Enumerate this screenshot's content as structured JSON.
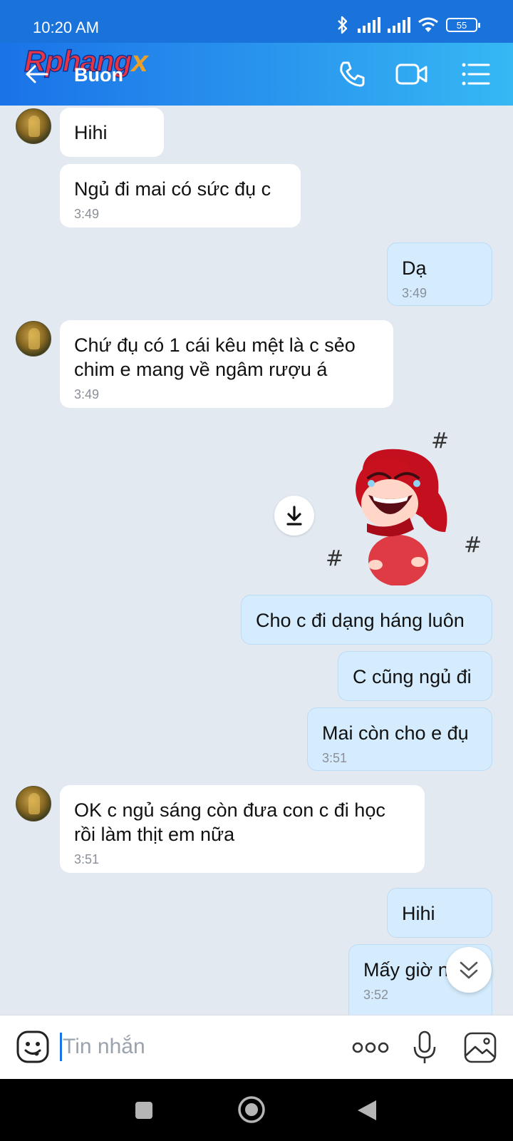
{
  "status_bar": {
    "time": "10:20 AM",
    "battery": "55"
  },
  "header": {
    "contact_name": "Buon",
    "watermark_main": "Rphang",
    "watermark_accent": "x"
  },
  "messages": [
    {
      "side": "in",
      "text": "Hihi",
      "time": ""
    },
    {
      "side": "in",
      "text": "Ngủ đi mai có sức đụ c",
      "time": "3:49"
    },
    {
      "side": "out",
      "text": "Dạ",
      "time": "3:49"
    },
    {
      "side": "in",
      "text": "Chứ đụ có 1 cái kêu mệt là c sẻo\nchim e mang về ngâm rượu á",
      "time": "3:49"
    },
    {
      "side": "out",
      "text": "Cho c đi dạng háng luôn",
      "time": ""
    },
    {
      "side": "out",
      "text": "C cũng ngủ đi",
      "time": ""
    },
    {
      "side": "out",
      "text": "Mai còn cho e đụ",
      "time": "3:51"
    },
    {
      "side": "in",
      "text": "OK c ngủ sáng còn đưa con c đi học\nrồi làm thịt em nữa",
      "time": "3:51"
    },
    {
      "side": "out",
      "text": "Hihi",
      "time": ""
    },
    {
      "side": "out",
      "text": "Mấy giờ nè",
      "time": "3:52"
    }
  ],
  "sticker": {
    "marks": [
      "#",
      "#",
      "#"
    ]
  },
  "composer": {
    "placeholder": "Tin nhắn"
  },
  "icons": {
    "back": "arrow-left-icon",
    "call": "phone-icon",
    "video": "video-camera-icon",
    "menu": "list-menu-icon",
    "download": "download-icon",
    "scroll": "chevron-double-down-icon",
    "emoji": "emoji-icon",
    "more": "more-dots-icon",
    "mic": "microphone-icon",
    "gallery": "image-icon"
  },
  "colors": {
    "header_start": "#1a73e8",
    "header_end": "#36b8f4",
    "outgoing_bubble": "#d4ecfd",
    "incoming_bubble": "#ffffff",
    "chat_background": "#e2e9f1"
  }
}
